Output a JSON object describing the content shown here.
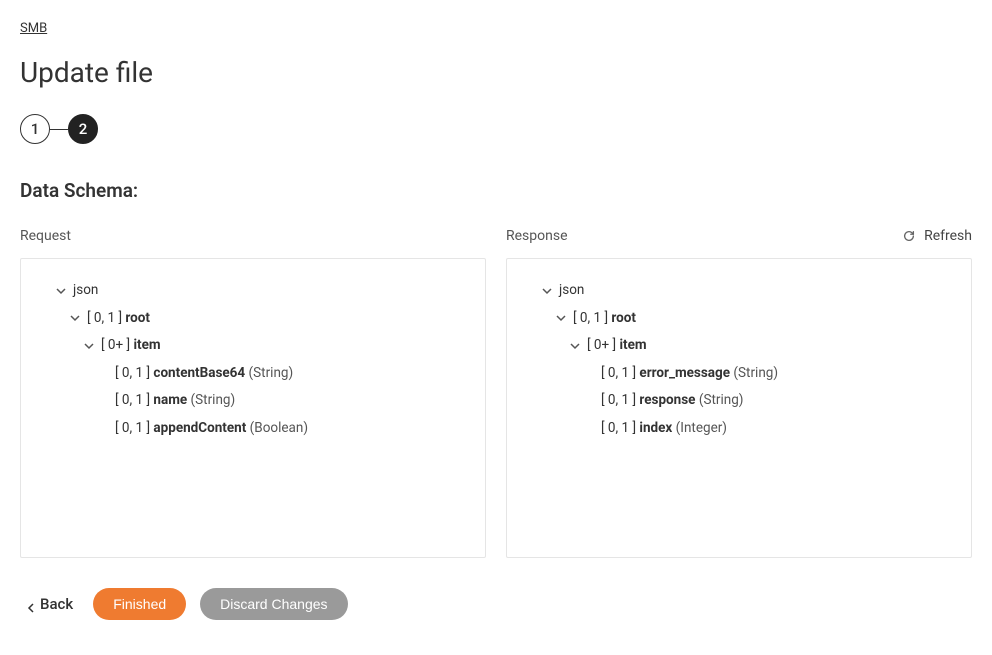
{
  "breadcrumb": "SMB",
  "page_title": "Update file",
  "steps": {
    "inactive": "1",
    "active": "2"
  },
  "section_heading": "Data Schema:",
  "refresh_label": "Refresh",
  "request": {
    "title": "Request",
    "tree": {
      "root_label": "json",
      "root": {
        "card": "[ 0, 1 ]",
        "name": "root"
      },
      "item": {
        "card": "[ 0+ ]",
        "name": "item"
      },
      "fields": [
        {
          "card": "[ 0, 1 ]",
          "name": "contentBase64",
          "type": "(String)"
        },
        {
          "card": "[ 0, 1 ]",
          "name": "name",
          "type": "(String)"
        },
        {
          "card": "[ 0, 1 ]",
          "name": "appendContent",
          "type": "(Boolean)"
        }
      ]
    }
  },
  "response": {
    "title": "Response",
    "tree": {
      "root_label": "json",
      "root": {
        "card": "[ 0, 1 ]",
        "name": "root"
      },
      "item": {
        "card": "[ 0+ ]",
        "name": "item"
      },
      "fields": [
        {
          "card": "[ 0, 1 ]",
          "name": "error_message",
          "type": "(String)"
        },
        {
          "card": "[ 0, 1 ]",
          "name": "response",
          "type": "(String)"
        },
        {
          "card": "[ 0, 1 ]",
          "name": "index",
          "type": "(Integer)"
        }
      ]
    }
  },
  "actions": {
    "back": "Back",
    "finished": "Finished",
    "discard": "Discard Changes"
  }
}
